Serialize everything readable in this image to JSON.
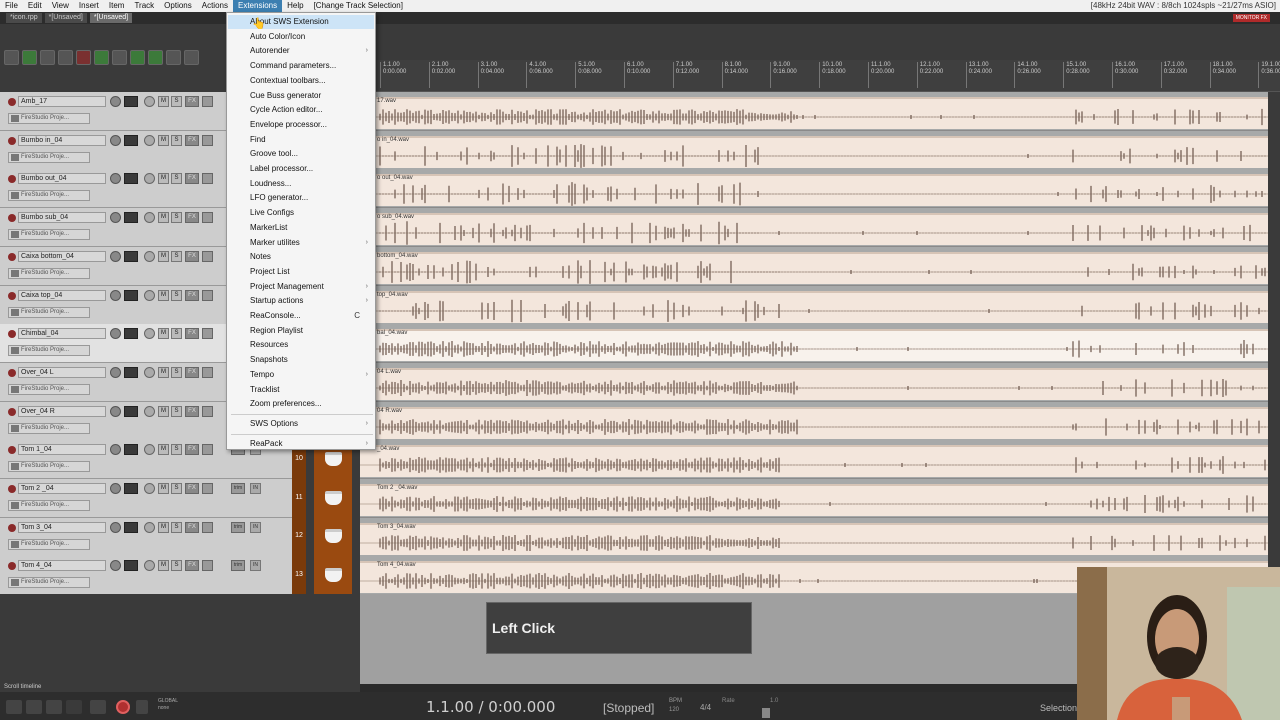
{
  "menubar": {
    "items": [
      "File",
      "Edit",
      "View",
      "Insert",
      "Item",
      "Track",
      "Options",
      "Actions",
      "Extensions",
      "Help",
      "[Change Track Selection]"
    ],
    "active_index": 8,
    "audio_status": "[48kHz 24bit WAV : 8/8ch 1024spls ~21/27ms ASIO]"
  },
  "tabs": [
    "*icon.rpp",
    "*[Unsaved]",
    "*[Unsaved]"
  ],
  "active_tab": 2,
  "monitor_fx": "MONITOR FX",
  "ruler": {
    "marks": [
      "1.1.00\n0:00.000",
      "2.1.00\n0:02.000",
      "3.1.00\n0:04.000",
      "4.1.00\n0:06.000",
      "5.1.00\n0:08.000",
      "6.1.00\n0:10.000",
      "7.1.00\n0:12.000",
      "8.1.00\n0:14.000",
      "9.1.00\n0:16.000",
      "10.1.00\n0:18.000",
      "11.1.00\n0:20.000",
      "12.1.00\n0:22.000",
      "13.1.00\n0:24.000",
      "14.1.00\n0:26.000",
      "15.1.00\n0:28.000",
      "16.1.00\n0:30.000",
      "17.1.00\n0:32.000",
      "18.1.00\n0:34.000",
      "19.1.00\n0:36.000"
    ]
  },
  "tracks": [
    {
      "name": "Amb_17",
      "input": "FireStudio Proje...",
      "item": "17.wav",
      "env": "FX",
      "selected": false
    },
    {
      "name": "Bumbo in_04",
      "input": "FireStudio Proje...",
      "item": "o in_04.wav",
      "env": "FX",
      "selected": false
    },
    {
      "name": "Bumbo out_04",
      "input": "FireStudio Proje...",
      "item": "o out_04.wav",
      "env": "FX",
      "selected": false
    },
    {
      "name": "Bumbo sub_04",
      "input": "FireStudio Proje...",
      "item": "o sub_04.wav",
      "env": "FX",
      "selected": false
    },
    {
      "name": "Caixa bottom_04",
      "input": "FireStudio Proje...",
      "item": "bottom_04.wav",
      "env": "FX",
      "selected": false
    },
    {
      "name": "Caixa top_04",
      "input": "FireStudio Proje...",
      "item": "top_04.wav",
      "env": "FX",
      "selected": false
    },
    {
      "name": "Chimbal_04",
      "input": "FireStudio Proje...",
      "item": "bal_04.wav",
      "env": "FX",
      "selected": true
    },
    {
      "name": "Over_04 L",
      "input": "FireStudio Proje...",
      "item": "04 L.wav",
      "env": "FX",
      "selected": false
    },
    {
      "name": "Over_04 R",
      "input": "FireStudio Proje...",
      "item": "04 R.wav",
      "env": "FX",
      "selected": false
    },
    {
      "name": "Tom 1_04",
      "input": "FireStudio Proje...",
      "item": "_04.wav",
      "env": "FX",
      "selected": false
    },
    {
      "name": "Tom 2 _04",
      "input": "FireStudio Proje...",
      "item": "Tom 2 _04.wav",
      "env": "FX",
      "selected": false
    },
    {
      "name": "Tom 3_04",
      "input": "FireStudio Proje...",
      "item": "Tom 3_04.wav",
      "env": "FX",
      "selected": false
    },
    {
      "name": "Tom 4_04",
      "input": "FireStudio Proje...",
      "item": "Tom 4_04.wav",
      "env": "FX",
      "selected": false
    }
  ],
  "track_buttons": {
    "mute": "M",
    "solo": "S",
    "trim": "trim",
    "in": "IN"
  },
  "track_numbers": [
    "10",
    "11",
    "12",
    "13"
  ],
  "extensions_menu": {
    "items": [
      {
        "label": "About SWS Extension",
        "sub": false,
        "highlight": true
      },
      {
        "label": "Auto Color/Icon",
        "sub": false
      },
      {
        "label": "Autorender",
        "sub": true
      },
      {
        "label": "Command parameters...",
        "sub": false
      },
      {
        "label": "Contextual toolbars...",
        "sub": false
      },
      {
        "label": "Cue Buss generator",
        "sub": false
      },
      {
        "label": "Cycle Action editor...",
        "sub": false
      },
      {
        "label": "Envelope processor...",
        "sub": false
      },
      {
        "label": "Find",
        "sub": false
      },
      {
        "label": "Groove tool...",
        "sub": false
      },
      {
        "label": "Label processor...",
        "sub": false
      },
      {
        "label": "Loudness...",
        "sub": false
      },
      {
        "label": "LFO generator...",
        "sub": false
      },
      {
        "label": "Live Configs",
        "sub": false
      },
      {
        "label": "MarkerList",
        "sub": false
      },
      {
        "label": "Marker utilites",
        "sub": true
      },
      {
        "label": "Notes",
        "sub": false
      },
      {
        "label": "Project List",
        "sub": false
      },
      {
        "label": "Project Management",
        "sub": true
      },
      {
        "label": "Startup actions",
        "sub": true
      },
      {
        "label": "ReaConsole...",
        "sub": false,
        "shortcut": "C"
      },
      {
        "label": "Region Playlist",
        "sub": false
      },
      {
        "label": "Resources",
        "sub": false
      },
      {
        "label": "Snapshots",
        "sub": false
      },
      {
        "label": "Tempo",
        "sub": true
      },
      {
        "label": "Tracklist",
        "sub": false
      },
      {
        "label": "Zoom preferences...",
        "sub": false
      },
      {
        "label": "SWS Options",
        "sub": true,
        "sep_before": true
      },
      {
        "label": "ReaPack",
        "sub": true,
        "sep_before": true
      }
    ]
  },
  "overlay": {
    "text": "Left Click"
  },
  "transport": {
    "time": "1.1.00 / 0:00.000",
    "state": "[Stopped]",
    "bpm_label": "BPM",
    "bpm": "120",
    "signature": "4/4",
    "rate_label": "Rate",
    "rate": "1.0",
    "global_label": "GLOBAL",
    "global_sub": "none",
    "selection_label": "Selection"
  },
  "scroll_label": "Scroll timeline",
  "colors": {
    "menu_highlight": "#3c7fb1",
    "item_bg": "#f3e6dc",
    "waveform": "#6b554a",
    "track_num_bg": "#7a3a0a"
  }
}
